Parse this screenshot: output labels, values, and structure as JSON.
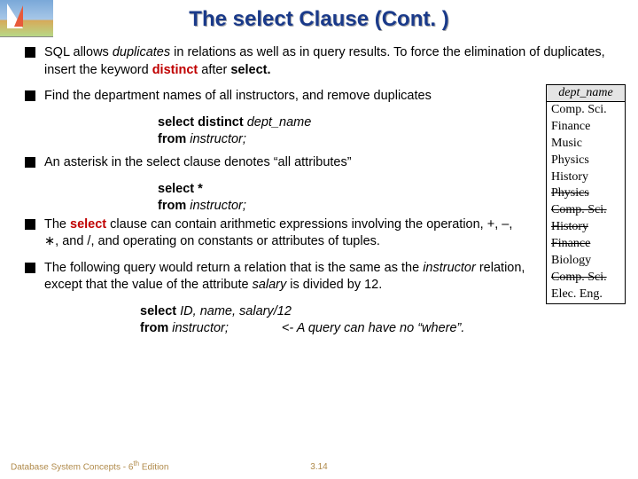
{
  "title": "The select Clause (Cont. )",
  "bullets": {
    "b1_pre": "SQL allows ",
    "b1_em": "duplicates",
    "b1_mid": " in relations as well as in query results. To force the elimination of duplicates, insert the keyword ",
    "b1_kw1": "distinct",
    "b1_mid2": " after ",
    "b1_kw2": "select.",
    "b2": "Find the department names of all instructors, and remove duplicates",
    "b3": "An asterisk in the select clause denotes “all attributes”",
    "b4_pre": "The ",
    "b4_kw": "select",
    "b4_mid": " clause can contain arithmetic expressions involving the operation, +, –, ∗, and /, and operating on constants or attributes of tuples.",
    "b5_pre": "The following query would return a relation that is the same as the ",
    "b5_em1": "instructor",
    "b5_mid": " relation, except that the value of the attribute ",
    "b5_em2": "salary",
    "b5_post": " is divided by 12."
  },
  "code1": {
    "l1a": "select distinct ",
    "l1b": "dept_name",
    "l2a": "from ",
    "l2b": "instructor;"
  },
  "code2": {
    "l1": "select *",
    "l2a": "from ",
    "l2b": "instructor;"
  },
  "code3": {
    "l1a": "select ",
    "l1b": "ID, name, salary/12",
    "l2a": "from ",
    "l2b": "instructor;",
    "note": "<- A query can have no “where”."
  },
  "table": {
    "header": "dept_name",
    "rows": [
      "Comp. Sci.",
      "Finance",
      "Music",
      "Physics",
      "History",
      "Physics",
      "Comp. Sci.",
      "History",
      "Finance",
      "Biology",
      "Comp. Sci.",
      "Elec. Eng."
    ],
    "struck": [
      5,
      6,
      7,
      8,
      10
    ]
  },
  "footer": {
    "left": "Database System Concepts - 6th Edition",
    "center": "3.14"
  }
}
